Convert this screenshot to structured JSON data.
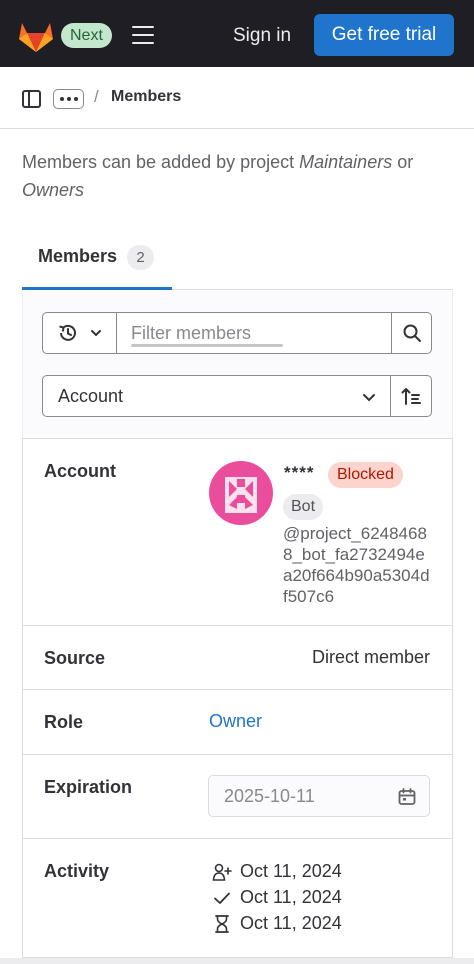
{
  "navbar": {
    "next_badge": "Next",
    "sign_in": "Sign in",
    "trial_button": "Get free trial"
  },
  "breadcrumb": {
    "separator": "/",
    "current": "Members"
  },
  "page": {
    "description_parts": [
      "Members can be added by project ",
      "Maintainers",
      " or ",
      "Owners"
    ]
  },
  "tabs": [
    {
      "label": "Members",
      "count": "2"
    }
  ],
  "filter": {
    "placeholder": "Filter members"
  },
  "sort": {
    "selected": "Account"
  },
  "member": {
    "labels": {
      "account": "Account",
      "source": "Source",
      "role": "Role",
      "expiration": "Expiration",
      "activity": "Activity"
    },
    "name_masked": "****",
    "status_badge": "Blocked",
    "type_badge": "Bot",
    "handle": "@project_62484688_bot_fa2732494ea20f664b90a5304df507c6",
    "source": "Direct member",
    "role": "Owner",
    "expiration_date": "2025-10-11",
    "activity": [
      {
        "icon": "user-add-icon",
        "date": "Oct 11, 2024"
      },
      {
        "icon": "check-icon",
        "date": "Oct 11, 2024"
      },
      {
        "icon": "hourglass-icon",
        "date": "Oct 11, 2024"
      }
    ]
  },
  "colors": {
    "navbar_bg": "#1f1e24",
    "primary_blue": "#1f75cb",
    "next_badge_bg": "#c3e6cd",
    "blocked_badge_bg": "#fdd4cd",
    "avatar_pink": "#e94d9b"
  }
}
